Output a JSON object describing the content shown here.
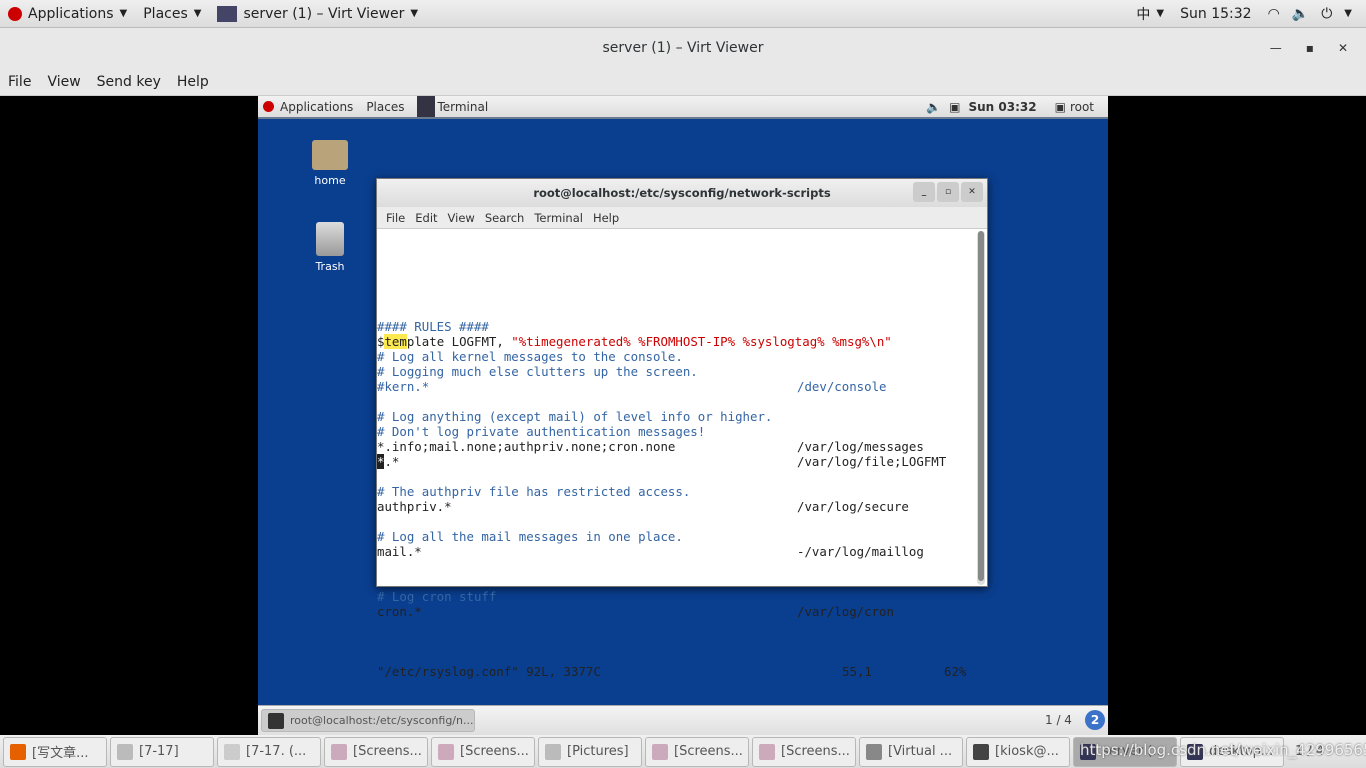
{
  "host_topbar": {
    "applications": "Applications",
    "places": "Places",
    "window": "server (1) – Virt Viewer",
    "input_method": "中",
    "clock": "Sun 15:32"
  },
  "viewer": {
    "title": "server (1) – Virt Viewer",
    "menu": [
      "File",
      "View",
      "Send key",
      "Help"
    ]
  },
  "guest_topbar": {
    "applications": "Applications",
    "places": "Places",
    "terminal": "Terminal",
    "clock": "Sun 03:32",
    "user": "root"
  },
  "desktop_icons": [
    {
      "label": "home"
    },
    {
      "label": "Trash"
    }
  ],
  "terminal": {
    "title": "root@localhost:/etc/sysconfig/network-scripts",
    "menu": [
      "File",
      "Edit",
      "View",
      "Search",
      "Terminal",
      "Help"
    ],
    "lines": [
      {
        "l": "#### RULES ####",
        "c": "cm"
      },
      {
        "tpl": true,
        "a": "$",
        "h": "tem",
        "b": "plate LOGFMT, ",
        "s": "\"%timegenerated% %FROMHOST-IP% %syslogtag% %msg%\\n\""
      },
      {
        "l": "# Log all kernel messages to the console.",
        "c": "cm"
      },
      {
        "l": "# Logging much else clutters up the screen.",
        "c": "cm"
      },
      {
        "l": "#kern.*",
        "r": "/dev/console",
        "c": "cm"
      },
      {
        "l": ""
      },
      {
        "l": "# Log anything (except mail) of level info or higher.",
        "c": "cm"
      },
      {
        "l": "# Don't log private authentication messages!",
        "c": "cm"
      },
      {
        "l": "*.info;mail.none;authpriv.none;cron.none",
        "r": "/var/log/messages",
        "c": "df"
      },
      {
        "cur": "*",
        "l": ".*",
        "r": "/var/log/file;LOGFMT",
        "c": "df"
      },
      {
        "l": ""
      },
      {
        "l": "# The authpriv file has restricted access.",
        "c": "cm"
      },
      {
        "l": "authpriv.*",
        "r": "/var/log/secure",
        "c": "df"
      },
      {
        "l": ""
      },
      {
        "l": "# Log all the mail messages in one place.",
        "c": "cm"
      },
      {
        "l": "mail.*",
        "r": "-/var/log/maillog",
        "c": "df"
      },
      {
        "l": ""
      },
      {
        "l": ""
      },
      {
        "l": "# Log cron stuff",
        "c": "cm"
      },
      {
        "l": "cron.*",
        "r": "/var/log/cron",
        "c": "df"
      },
      {
        "l": ""
      }
    ],
    "status": {
      "file": "\"/etc/rsyslog.conf\" 92L, 3377C",
      "pos": "55,1",
      "pct": "62%"
    }
  },
  "guest_taskbar": {
    "item": "root@localhost:/etc/sysconfig/n...",
    "workspace": "1 / 4",
    "badge": "2"
  },
  "host_taskbar": {
    "items": [
      "[写文章...",
      "[7-17]",
      "[7-17. (...",
      "[Screens...",
      "[Screens...",
      "[Pictures]",
      "[Screens...",
      "[Screens...",
      "[Virtual ...",
      "[kiosk@...",
      "server (...",
      "desktop..."
    ],
    "active_index": 10,
    "workspace": "1 / 4",
    "watermark": "https://blog.csdn.net/weixin_42996565"
  }
}
